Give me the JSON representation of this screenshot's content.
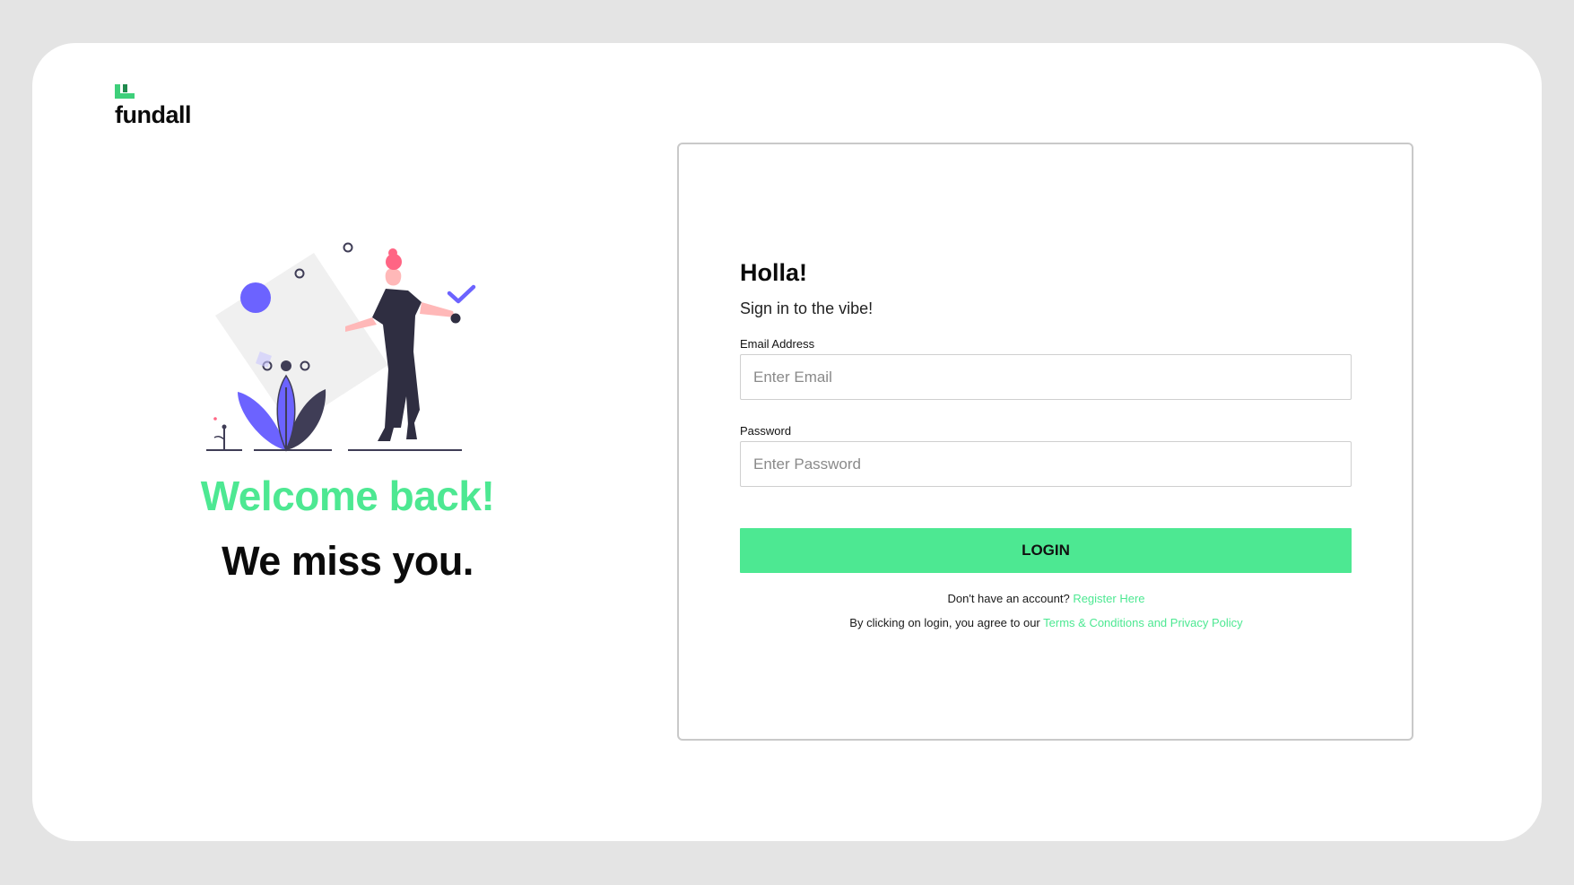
{
  "brand": {
    "name": "fundall",
    "accent_color": "#4de892",
    "logo_mark_color": "#3ecf7a"
  },
  "hero": {
    "illustration": "woman-checklist-illustration",
    "welcome": "Welcome back!",
    "message": "We miss you."
  },
  "form": {
    "greeting": "Holla!",
    "subtitle": "Sign in to the vibe!",
    "email": {
      "label": "Email Address",
      "placeholder": "Enter Email",
      "value": ""
    },
    "password": {
      "label": "Password",
      "placeholder": "Enter Password",
      "value": ""
    },
    "login_label": "LOGIN",
    "register_prompt": "Don't have an account?",
    "register_link": "Register Here",
    "terms_prefix": "By clicking on login, you agree to our",
    "terms_link": "Terms & Conditions and Privacy Policy"
  }
}
